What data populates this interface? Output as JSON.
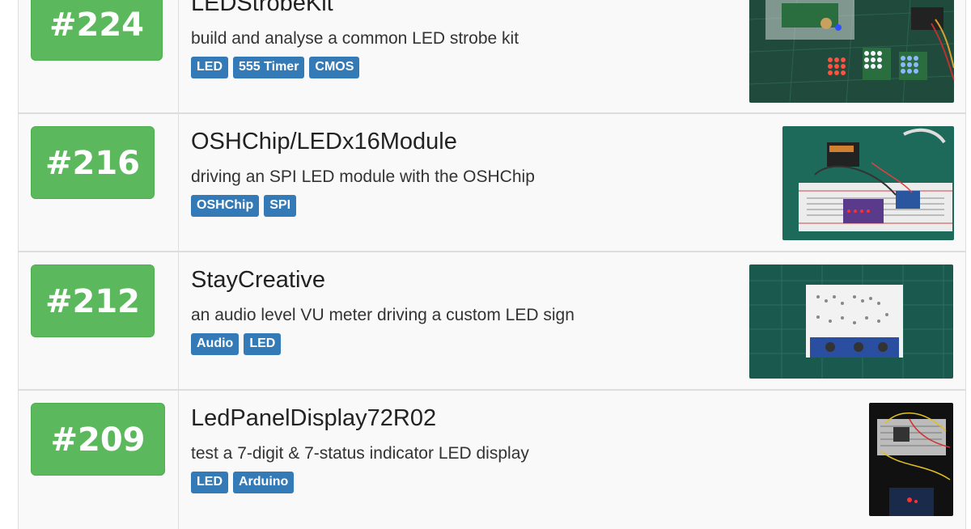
{
  "projects": [
    {
      "number": "#224",
      "title": "LEDStrobeKit",
      "description": "build and analyse a common LED strobe kit",
      "tags": [
        "LED",
        "555 Timer",
        "CMOS"
      ]
    },
    {
      "number": "#216",
      "title": "OSHChip/LEDx16Module",
      "description": "driving an SPI LED module with the OSHChip",
      "tags": [
        "OSHChip",
        "SPI"
      ]
    },
    {
      "number": "#212",
      "title": "StayCreative",
      "description": "an audio level VU meter driving a custom LED sign",
      "tags": [
        "Audio",
        "LED"
      ]
    },
    {
      "number": "#209",
      "title": "LedPanelDisplay72R02",
      "description": "test a 7-digit & 7-status indicator LED display",
      "tags": [
        "LED",
        "Arduino"
      ]
    }
  ],
  "colors": {
    "number_badge": "#5cb85c",
    "tag": "#337ab7",
    "row_background": "#f9f9f9"
  }
}
